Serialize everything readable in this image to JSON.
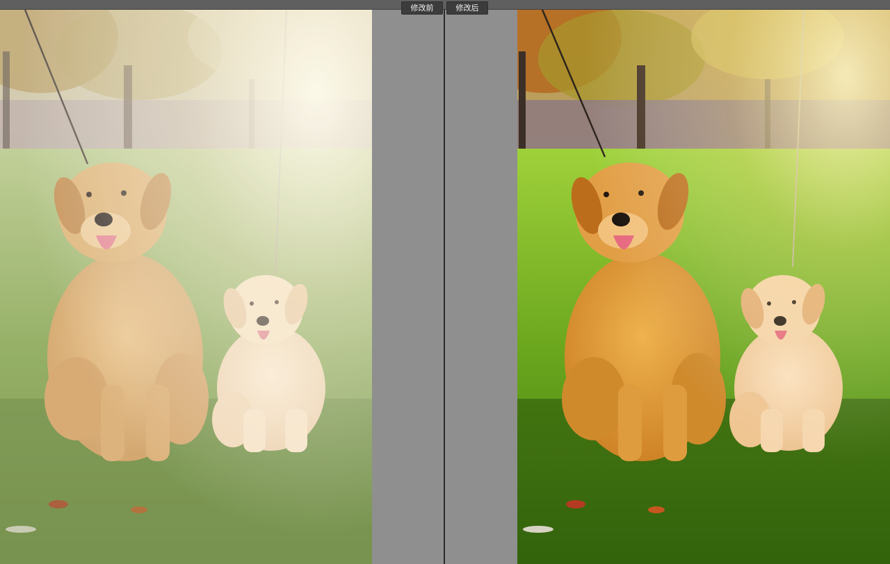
{
  "comparison": {
    "before_label": "修改前",
    "after_label": "修改后"
  },
  "photos": {
    "before": {
      "alt": "",
      "tone": "washed-out"
    },
    "after": {
      "alt": "",
      "tone": "warm-saturated"
    }
  },
  "colors": {
    "panel_background": "#8f8f8f",
    "toolbar_background": "#5f5f5f",
    "tab_background": "#3c3c3c",
    "divider": "#2b2b2b"
  }
}
